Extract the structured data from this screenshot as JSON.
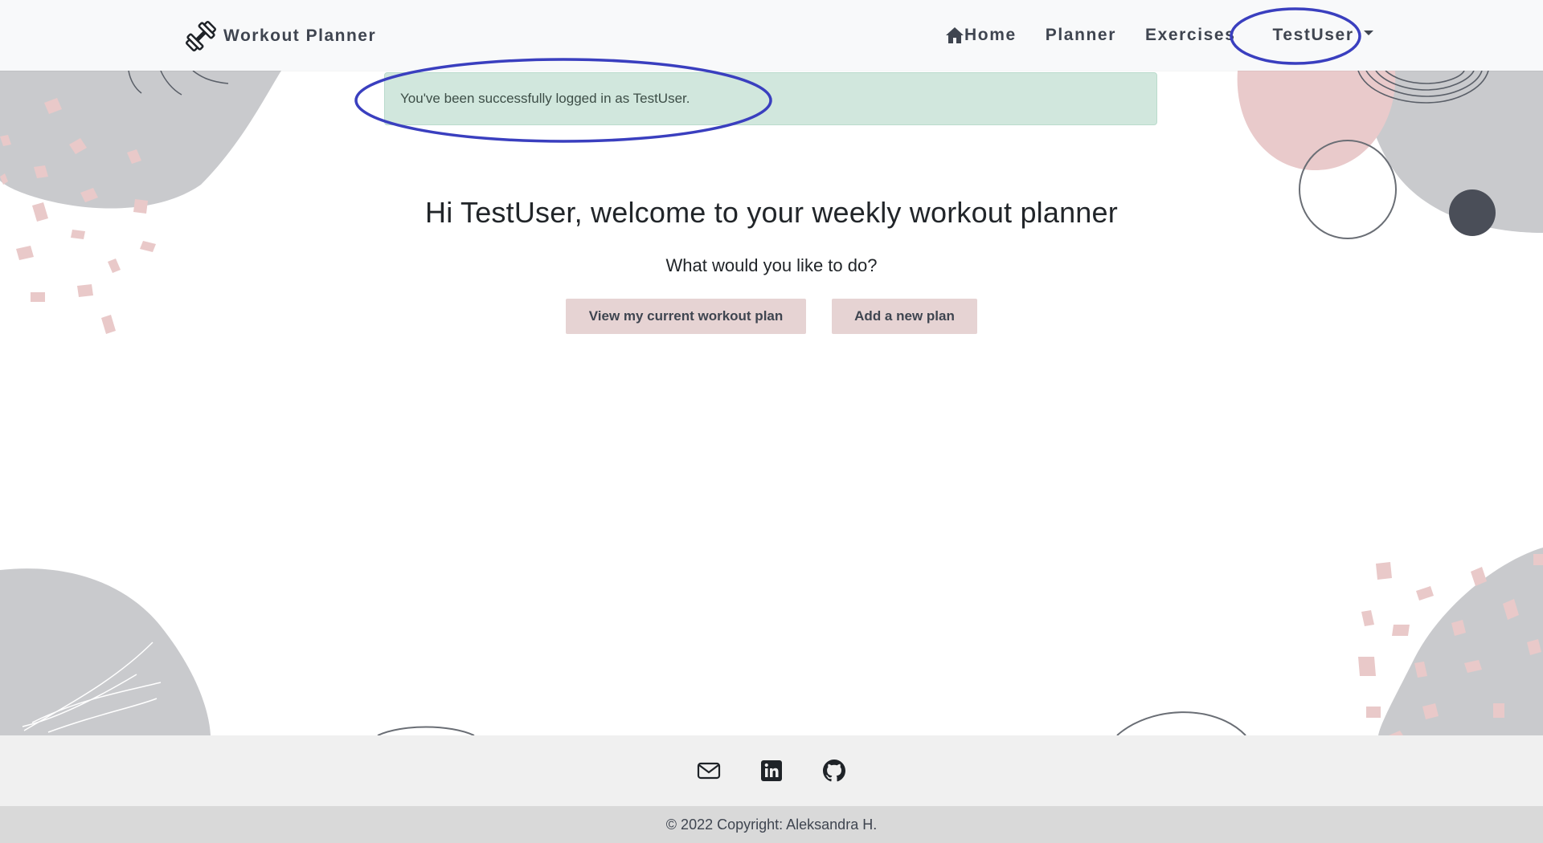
{
  "navbar": {
    "brand_label": "Workout Planner",
    "brand_icon": "dumbbell-icon",
    "links": [
      {
        "label": "Home",
        "icon": "home-icon"
      },
      {
        "label": "Planner"
      },
      {
        "label": "Exercises"
      },
      {
        "label": "TestUser",
        "icon": "caret-down-icon"
      }
    ]
  },
  "alert": {
    "message": "You've been successfully logged in as TestUser.",
    "color": "#d1e7dd"
  },
  "main": {
    "heading": "Hi TestUser, welcome to your weekly workout planner",
    "subheading": "What would you like to do?",
    "buttons": {
      "view_plan": "View my current workout plan",
      "add_plan": "Add a new plan"
    },
    "button_color": "#e6d3d3"
  },
  "footer": {
    "icons": [
      "mail-icon",
      "linkedin-icon",
      "github-icon"
    ],
    "copyright": "© 2022 Copyright: Aleksandra H."
  },
  "annotations": {
    "color": "#3a3fbf",
    "highlighted": [
      "user-dropdown",
      "login-alert-message"
    ]
  }
}
